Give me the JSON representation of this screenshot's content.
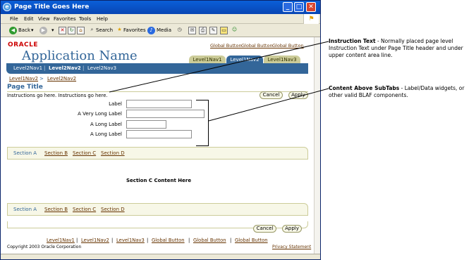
{
  "window": {
    "title": "Page Title Goes Here",
    "controls": [
      "_",
      "□",
      "✕"
    ]
  },
  "menu": [
    "File",
    "Edit",
    "View",
    "Favorites",
    "Tools",
    "Help"
  ],
  "toolbar": {
    "back": "Back",
    "search": "Search",
    "favorites": "Favorites",
    "media": "Media"
  },
  "branding": {
    "logo": "ORACLE",
    "app_name": "Application Name"
  },
  "global_buttons": [
    "Global Button",
    "Global Button",
    "Global Button"
  ],
  "level1_tabs": [
    {
      "label": "Level1Nav1",
      "active": false
    },
    {
      "label": "Level1Nav2",
      "active": true
    },
    {
      "label": "Level1Nav3",
      "active": false
    }
  ],
  "level2_nav": [
    {
      "label": "Level2Nav1",
      "active": false
    },
    {
      "label": "Level2Nav2",
      "active": true
    },
    {
      "label": "Level2Nav3",
      "active": false
    }
  ],
  "level3_nav": {
    "item1": "Level1Nav2",
    "separator": ">",
    "item2": "Level2Nav2"
  },
  "page": {
    "title": "Page Title",
    "instructions": "Instructions go here. Instructions go here.",
    "cancel_label": "Cancel",
    "apply_label": "Apply"
  },
  "form": {
    "fields": [
      {
        "label": "Label"
      },
      {
        "label": "A Very Long Label"
      },
      {
        "label": "A Long Label"
      },
      {
        "label": "A Long Label"
      }
    ]
  },
  "subtabs": [
    {
      "label": "Section A",
      "active": true
    },
    {
      "label": "Section B",
      "active": false
    },
    {
      "label": "Section C",
      "active": false
    },
    {
      "label": "Section D",
      "active": false
    }
  ],
  "section_content": "Section C Content Here",
  "footer": {
    "links": [
      "Level1Nav1",
      "Level1Nav2",
      "Level1Nav3",
      "Global Button",
      "Global Button",
      "Global Button"
    ],
    "copyright": "Copyright 2003 Oracle Corporation",
    "privacy": "Privacy Statement"
  },
  "annotations": {
    "instruction": {
      "title": "Instruction Text",
      "body": " - Normally placed page level Instruction Text under Page Title header and under upper content area line."
    },
    "content_above": {
      "title": "Content Above SubTabs",
      "body": " - Label/Data widgets, or other valid BLAF components."
    }
  },
  "colors": {
    "brand_blue": "#336699",
    "tab_tan": "#cccc99",
    "link_brown": "#663300",
    "oracle_red": "#cc0000"
  }
}
